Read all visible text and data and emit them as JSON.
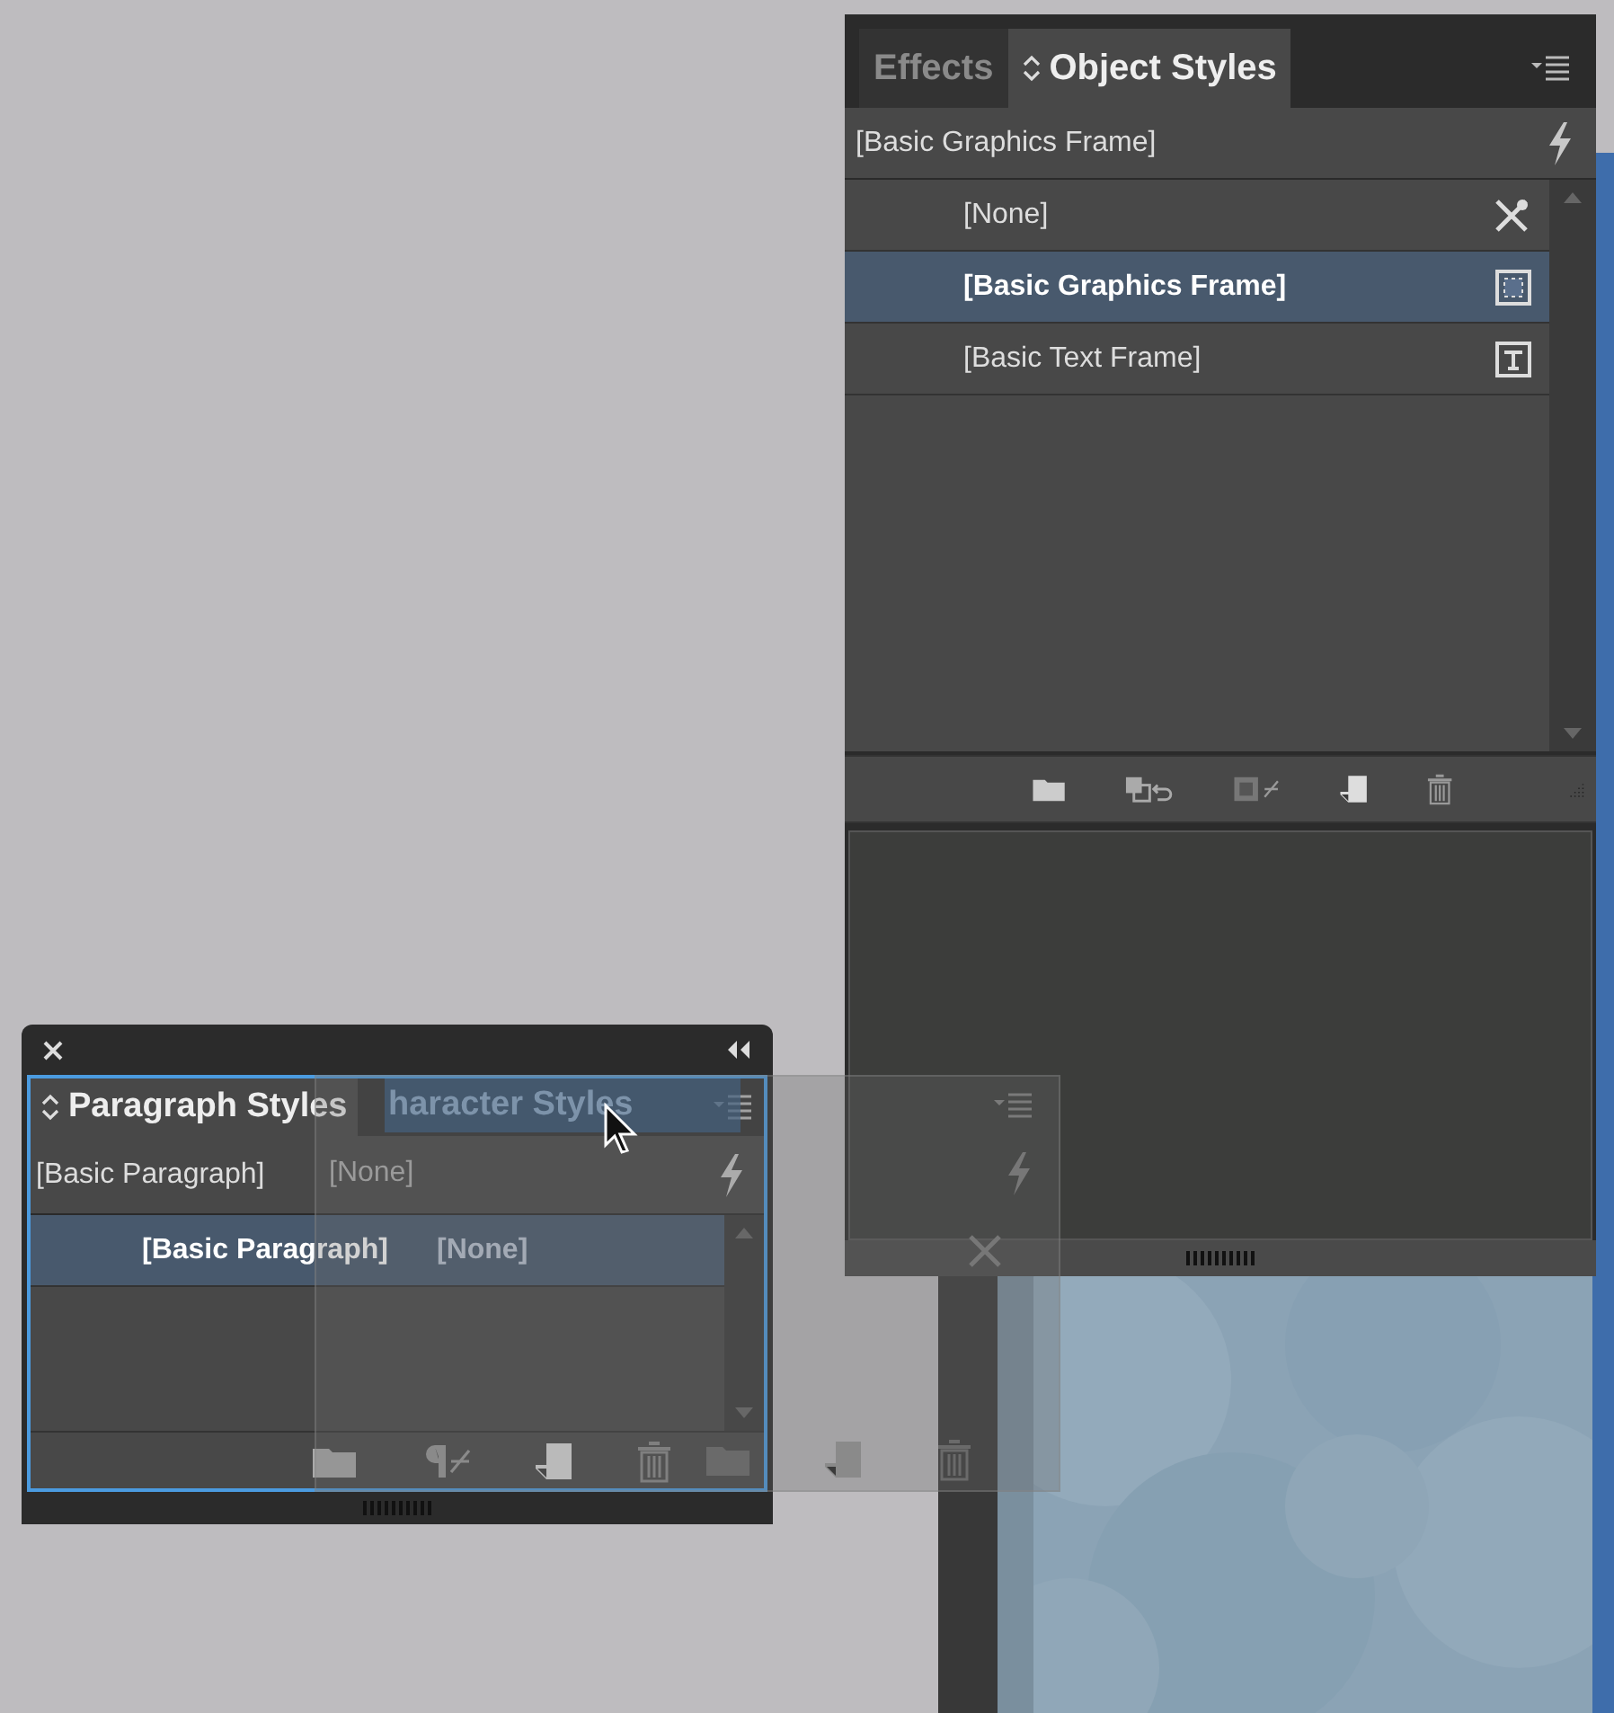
{
  "object_styles_panel": {
    "tabs": [
      {
        "label": "Effects",
        "selected": false
      },
      {
        "label": "Object Styles",
        "selected": true
      }
    ],
    "current_style": "[Basic Graphics Frame]",
    "styles": [
      {
        "label": "[None]",
        "selected": false,
        "kind": "none"
      },
      {
        "label": "[Basic Graphics Frame]",
        "selected": true,
        "kind": "graphics"
      },
      {
        "label": "[Basic Text Frame]",
        "selected": false,
        "kind": "text"
      }
    ]
  },
  "paragraph_styles_panel": {
    "tab": {
      "label": "Paragraph Styles",
      "selected": true
    },
    "current_style": "[Basic Paragraph]",
    "styles": [
      {
        "label": "[Basic Paragraph]",
        "selected": true
      }
    ]
  },
  "dragged_character_styles_panel": {
    "tab_label": "haracter Styles",
    "current_style": "[None]",
    "styles": [
      {
        "label": "[None]"
      }
    ]
  }
}
